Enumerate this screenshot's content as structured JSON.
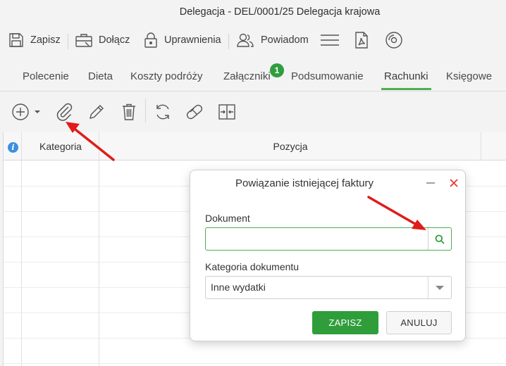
{
  "window": {
    "title": "Delegacja - DEL/0001/25 Delegacja krajowa"
  },
  "toolbar": {
    "save_label": "Zapisz",
    "attach_label": "Dołącz",
    "permissions_label": "Uprawnienia",
    "notify_label": "Powiadom"
  },
  "tabs": [
    {
      "label": "Polecenie"
    },
    {
      "label": "Dieta"
    },
    {
      "label": "Koszty podróży"
    },
    {
      "label": "Załączniki",
      "badge": "1"
    },
    {
      "label": "Podsumowanie"
    },
    {
      "label": "Rachunki",
      "active": true
    },
    {
      "label": "Księgowe"
    }
  ],
  "grid": {
    "columns": [
      "Kategoria",
      "Pozycja"
    ]
  },
  "dialog": {
    "title": "Powiązanie istniejącej faktury",
    "document_label": "Dokument",
    "document_value": "",
    "category_label": "Kategoria dokumentu",
    "category_value": "Inne wydatki",
    "save_label": "ZAPISZ",
    "cancel_label": "ANULUJ"
  },
  "colors": {
    "accent": "#4caf50",
    "primary_button": "#2f9e3a",
    "badge": "#2e9e3e",
    "close": "#e53935",
    "annotation_arrow": "#e01b1b",
    "info": "#3d8fe0"
  }
}
